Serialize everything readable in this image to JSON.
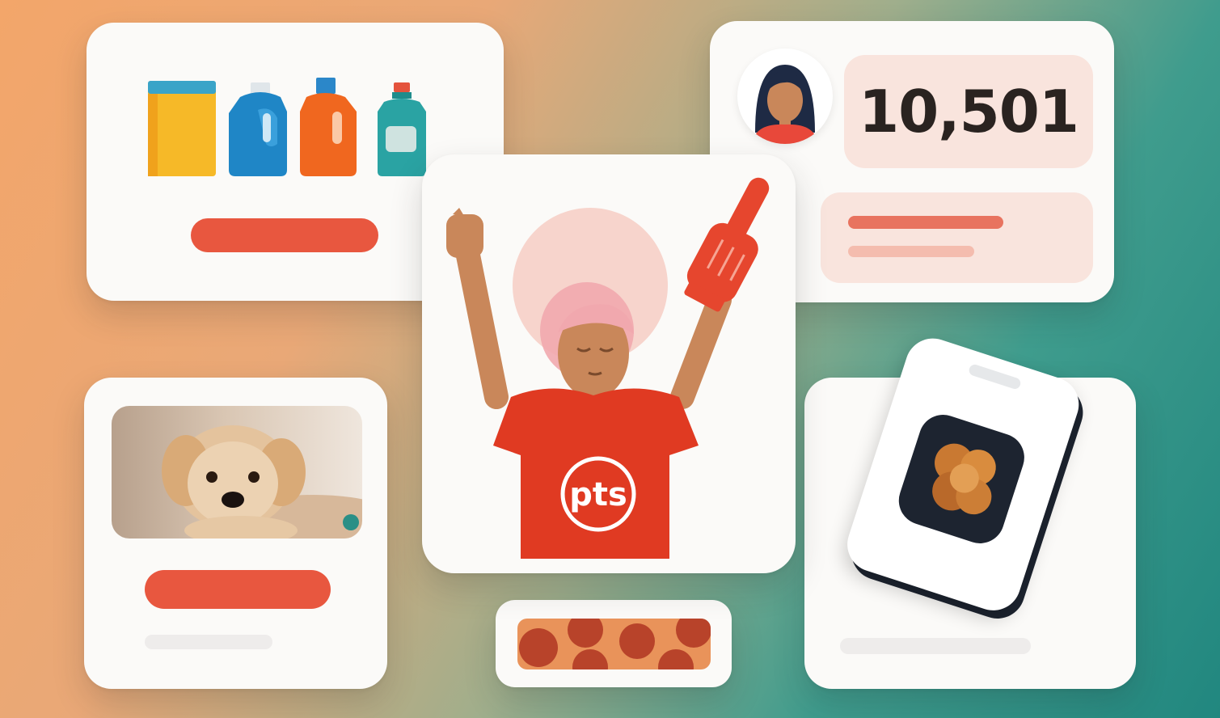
{
  "illustration": {
    "theme": "loyalty rewards app collage",
    "colors": {
      "accent": "#e8573f",
      "shirt": "#e03a22",
      "background_start": "#f3a66a",
      "background_end": "#21877f",
      "card": "#fbfaf8"
    }
  },
  "cards": {
    "products": {
      "icons": [
        "box-icon",
        "blue-detergent-bottle-icon",
        "orange-detergent-bottle-icon",
        "teal-bottle-icon"
      ]
    },
    "points": {
      "value": "10,501",
      "icon": "woman-avatar-icon"
    },
    "fan": {
      "shirt_text": "pts",
      "icons": [
        "foam-finger-icon",
        "raised-fist-icon"
      ]
    },
    "pet": {
      "icon": "dog-photo"
    },
    "phone": {
      "icon": "fried-food-icon"
    },
    "food_strip": {
      "icon": "pepperoni-pizza-icon"
    }
  }
}
